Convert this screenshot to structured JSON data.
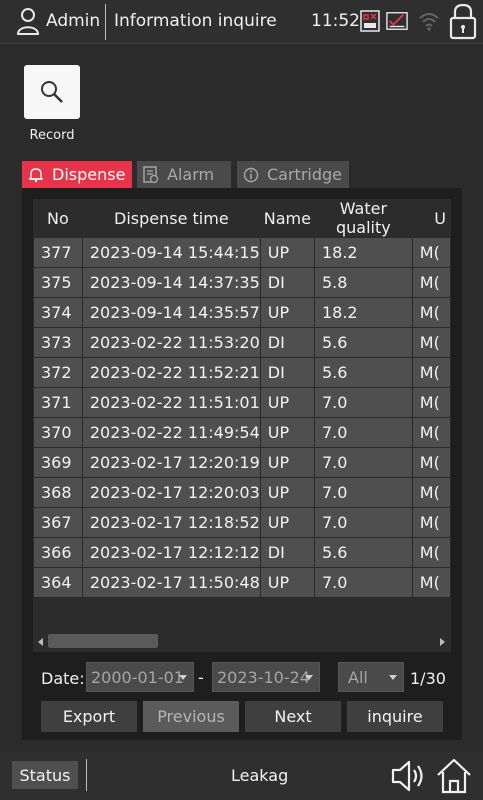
{
  "header": {
    "user_icon": "user-icon",
    "user": "Admin",
    "title": "Information inquire",
    "time": "11:52",
    "status_icons": [
      "usb-status-icon",
      "checklist-status-icon",
      "wifi-icon",
      "lock-icon"
    ]
  },
  "record": {
    "label": "Record",
    "icon": "search-icon"
  },
  "tabs": [
    {
      "label": "Dispense",
      "icon": "bell-icon",
      "active": true
    },
    {
      "label": "Alarm",
      "icon": "alarm-list-icon",
      "active": false
    },
    {
      "label": "Cartridge",
      "icon": "info-icon",
      "active": false
    }
  ],
  "table": {
    "columns": [
      "No",
      "Dispense time",
      "Name",
      "Water quality",
      "U"
    ],
    "rows": [
      [
        "377",
        "2023-09-14 15:44:15",
        "UP",
        "18.2",
        "M("
      ],
      [
        "375",
        "2023-09-14 14:37:35",
        "DI",
        "5.8",
        "M("
      ],
      [
        "374",
        "2023-09-14 14:35:57",
        "UP",
        "18.2",
        "M("
      ],
      [
        "373",
        "2023-02-22 11:53:20",
        "DI",
        "5.6",
        "M("
      ],
      [
        "372",
        "2023-02-22 11:52:21",
        "DI",
        "5.6",
        "M("
      ],
      [
        "371",
        "2023-02-22 11:51:01",
        "UP",
        "7.0",
        "M("
      ],
      [
        "370",
        "2023-02-22 11:49:54",
        "UP",
        "7.0",
        "M("
      ],
      [
        "369",
        "2023-02-17 12:20:19",
        "UP",
        "7.0",
        "M("
      ],
      [
        "368",
        "2023-02-17 12:20:03",
        "UP",
        "7.0",
        "M("
      ],
      [
        "367",
        "2023-02-17 12:18:52",
        "UP",
        "7.0",
        "M("
      ],
      [
        "366",
        "2023-02-17 12:12:12",
        "DI",
        "5.6",
        "M("
      ],
      [
        "364",
        "2023-02-17 11:50:48",
        "UP",
        "7.0",
        "M("
      ]
    ]
  },
  "filter": {
    "date_label": "Date:",
    "date_from": "2000-01-01",
    "separator": "-",
    "date_to": "2023-10-24",
    "type_value": "All",
    "page_indicator": "1/30"
  },
  "buttons": {
    "export": "Export",
    "previous": "Previous",
    "next": "Next",
    "inquire": "inquire"
  },
  "footer": {
    "status_label": "Status",
    "alert_text": "Leakag",
    "speaker_icon": "speaker-icon",
    "home_icon": "home-icon"
  },
  "colors": {
    "accent": "#e8344a",
    "background": "#2b2b2b",
    "cell": "#4f4f4f"
  }
}
